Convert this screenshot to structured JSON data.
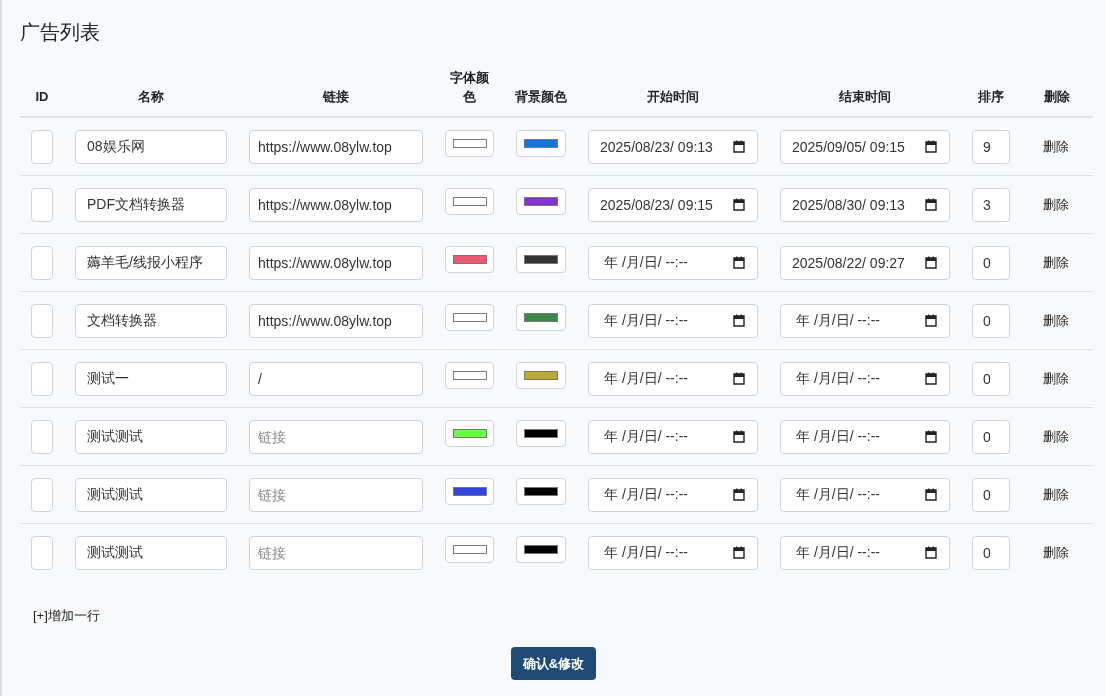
{
  "title": "广告列表",
  "columns": [
    "ID",
    "名称",
    "链接",
    "字体颜色",
    "背景颜色",
    "开始时间",
    "结束时间",
    "排序",
    "删除"
  ],
  "rows": [
    {
      "name": "08娱乐网",
      "link": {
        "value": "https://www.08ylw.top"
      },
      "font_swatch": {
        "color": "#ffffff"
      },
      "bg_swatch": {
        "color": "#1177dd"
      },
      "start": {
        "value": "2025/08/23/ 09:13"
      },
      "end": {
        "value": "2025/09/05/ 09:15"
      },
      "order": "9",
      "delete": "删除"
    },
    {
      "name": "PDF文档转换器",
      "link": {
        "value": "https://www.08ylw.top"
      },
      "font_swatch": {
        "color": "#ffffff"
      },
      "bg_swatch": {
        "color": "#8833cc"
      },
      "start": {
        "value": "2025/08/23/ 09:15"
      },
      "end": {
        "value": "2025/08/30/ 09:13"
      },
      "order": "3",
      "delete": "删除"
    },
    {
      "name": "薅羊毛/线报小程序",
      "link": {
        "value": "https://www.08ylw.top"
      },
      "font_swatch": {
        "color": "#e85a70"
      },
      "bg_swatch": {
        "color": "#333333"
      },
      "start": {
        "placeholder": "年 /月/日/ --:--"
      },
      "end": {
        "value": "2025/08/22/ 09:27"
      },
      "order": "0",
      "delete": "删除"
    },
    {
      "name": "文档转换器",
      "link": {
        "value": "https://www.08ylw.top"
      },
      "font_swatch": {
        "color": "#ffffff"
      },
      "bg_swatch": {
        "color": "#3a8a4a"
      },
      "start": {
        "placeholder": "年 /月/日/ --:--"
      },
      "end": {
        "placeholder": "年 /月/日/ --:--"
      },
      "order": "0",
      "delete": "删除"
    },
    {
      "name": "测试一",
      "link": {
        "value": "/"
      },
      "font_swatch": {
        "color": "#ffffff"
      },
      "bg_swatch": {
        "color": "#bbaa33"
      },
      "start": {
        "placeholder": "年 /月/日/ --:--"
      },
      "end": {
        "placeholder": "年 /月/日/ --:--"
      },
      "order": "0",
      "delete": "删除"
    },
    {
      "name": "测试测试",
      "link": {
        "placeholder": "链接"
      },
      "font_swatch": {
        "color": "#66ff44"
      },
      "bg_swatch": {
        "color": "#000000"
      },
      "start": {
        "placeholder": "年 /月/日/ --:--"
      },
      "end": {
        "placeholder": "年 /月/日/ --:--"
      },
      "order": "0",
      "delete": "删除"
    },
    {
      "name": "测试测试",
      "link": {
        "placeholder": "链接"
      },
      "font_swatch": {
        "color": "#3344dd"
      },
      "bg_swatch": {
        "color": "#000000"
      },
      "start": {
        "placeholder": "年 /月/日/ --:--"
      },
      "end": {
        "placeholder": "年 /月/日/ --:--"
      },
      "order": "0",
      "delete": "删除"
    },
    {
      "name": "测试测试",
      "link": {
        "placeholder": "链接"
      },
      "font_swatch": {
        "color": "#ffffff"
      },
      "bg_swatch": {
        "color": "#000000"
      },
      "start": {
        "placeholder": "年 /月/日/ --:--"
      },
      "end": {
        "placeholder": "年 /月/日/ --:--"
      },
      "order": "0",
      "delete": "删除"
    }
  ],
  "add_row": "[+]增加一行",
  "submit": "确认&修改"
}
